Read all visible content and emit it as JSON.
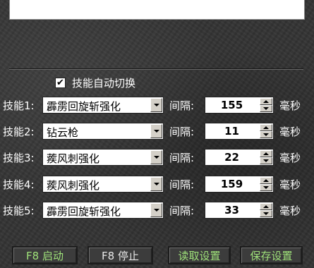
{
  "log_box": {
    "text": ""
  },
  "auto_switch": {
    "checked": true,
    "check_glyph": "✔",
    "label": "技能自动切换"
  },
  "skills": [
    {
      "label": "技能1:",
      "skill": "霹雳回旋斩强化",
      "interval_label": "间隔:",
      "interval": "155",
      "unit": "毫秒"
    },
    {
      "label": "技能2:",
      "skill": "钻云枪",
      "interval_label": "间隔:",
      "interval": "11",
      "unit": "毫秒"
    },
    {
      "label": "技能3:",
      "skill": "蒺风刺强化",
      "interval_label": "间隔:",
      "interval": "22",
      "unit": "毫秒"
    },
    {
      "label": "技能4:",
      "skill": "蒺风刺强化",
      "interval_label": "间隔:",
      "interval": "159",
      "unit": "毫秒"
    },
    {
      "label": "技能5:",
      "skill": "霹雳回旋斩强化",
      "interval_label": "间隔:",
      "interval": "33",
      "unit": "毫秒"
    }
  ],
  "buttons": {
    "start": "F8 启动",
    "stop": "F8 停止",
    "load": "读取设置",
    "save": "保存设置"
  },
  "colors": {
    "enabled_button_text": "#9fe27a",
    "disabled_button_text": "#e8e8e8",
    "label_text": "#ffffff"
  }
}
